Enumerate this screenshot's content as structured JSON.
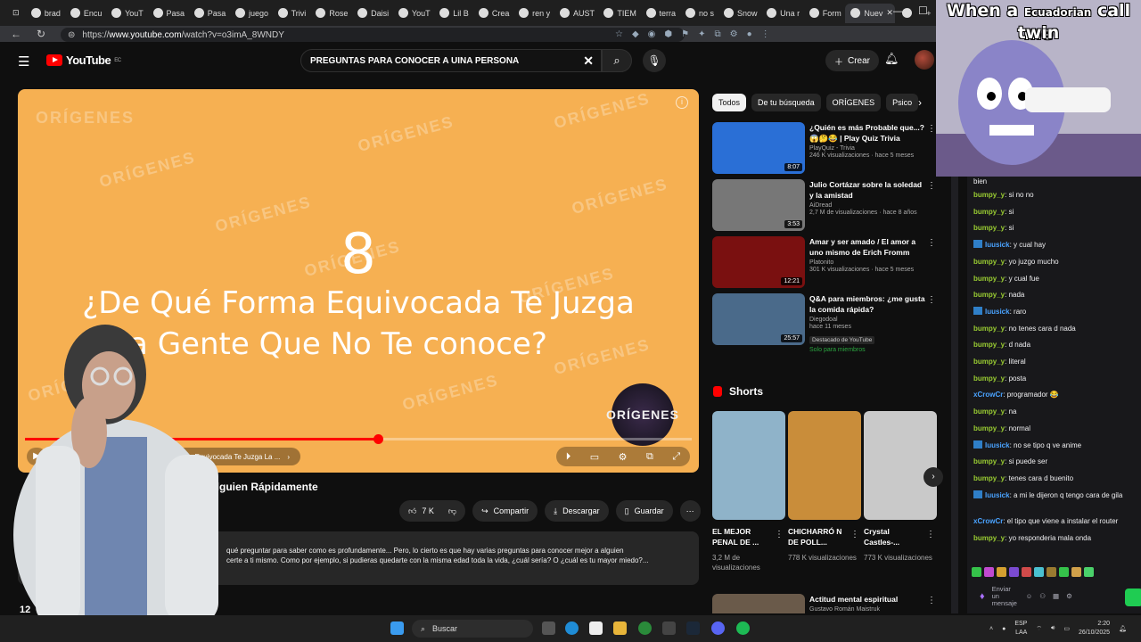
{
  "browser": {
    "tabs": [
      "brad",
      "Encu",
      "YouT",
      "Pasa",
      "Pasa",
      "juego",
      "Trivi",
      "Rose",
      "Daisi",
      "YouT",
      "Lil B",
      "Crea",
      "ren y",
      "AUST",
      "TIEM",
      "terra",
      "no s",
      "Snow",
      "Una r",
      "Form",
      "Nuev",
      ""
    ],
    "url_prefix": "https://",
    "url_host": "www.youtube.com",
    "url_path": "/watch?v=o3imA_8WNDY"
  },
  "youtube": {
    "logo_text": "YouTube",
    "logo_country": "EC",
    "search_value": "PREGUNTAS PARA CONOCER A UINA PERSONA",
    "create_label": "Crear"
  },
  "player": {
    "watermark": "ORÍGENES",
    "number": "8",
    "question_line1": "¿De Qué Forma Equivocada Te Juzga",
    "question_line2": "La Gente Que No Te conoce?",
    "chapter_label": "ué Forma Equivocada Te Juzga La ...",
    "channel_logo_text": "ORÍGENES",
    "progress_fraction": 0.53
  },
  "video": {
    "title_visible": "Alguien Rápidamente",
    "likes": "7 K",
    "share_label": "Compartir",
    "download_label": "Descargar",
    "save_label": "Guardar",
    "description_line1": "qué preguntar para saber como es profundamente... Pero, lo cierto es que hay varias preguntas para conocer mejor a alguien",
    "description_line2": "certe a ti mismo. Como por ejemplo, si pudieras quedarte con la misma edad toda la vida, ¿cuál sería? O ¿cuál es tu mayor miedo?...",
    "view_fragment": "12"
  },
  "sidebar": {
    "chips": [
      "Todos",
      "De tu búsqueda",
      "ORÍGENES",
      "Psico"
    ],
    "recommendations": [
      {
        "title": "¿Quién es más Probable que...? 😱🤔😂 | Play Quiz Trivia",
        "channel": "PlayQuiz - Trivia",
        "views": "246 K visualizaciones · hace 5 meses",
        "duration": "8:07",
        "thumb_color": "#2a6fd6",
        "badge": "",
        "badge2": ""
      },
      {
        "title": "Julio Cortázar sobre la soledad y la amistad",
        "channel": "AiDread",
        "views": "2,7 M de visualizaciones · hace 8 años",
        "duration": "3:53",
        "thumb_color": "#777777",
        "badge": "",
        "badge2": ""
      },
      {
        "title": "Amar y ser amado / El amor a uno mismo de Erich Fromm",
        "channel": "Platonito",
        "views": "301 K visualizaciones · hace 5 meses",
        "duration": "12:21",
        "thumb_color": "#7a1010",
        "badge": "",
        "badge2": ""
      },
      {
        "title": "Q&A para miembros: ¿me gusta la comida rápida?",
        "channel": "Diegodoal",
        "views": "hace 11 meses",
        "duration": "25:57",
        "thumb_color": "#4a6a8a",
        "badge": "Destacado de YouTube",
        "badge2": "Solo para miembros"
      }
    ],
    "shorts_heading": "Shorts",
    "shorts": [
      {
        "title": "EL MEJOR PENAL DE ...",
        "views": "3,2 M de visualizaciones",
        "color": "#8fb3c9"
      },
      {
        "title": "CHICHARRÓ N DE POLL...",
        "views": "778 K visualizaciones",
        "color": "#c98d3a"
      },
      {
        "title": "Crystal Castles-...",
        "views": "773 K visualizaciones",
        "color": "#c9c9c9"
      }
    ],
    "last_rec_title": "Actitud mental espiritual",
    "last_rec_channel": "Gustavo Román Maistruk"
  },
  "chat": {
    "top_fragment": "bien",
    "messages": [
      {
        "user": "bumpy_y",
        "text": "si no no",
        "mod": false,
        "color": "#9acd32"
      },
      {
        "user": "bumpy_y",
        "text": "si",
        "mod": false,
        "color": "#9acd32"
      },
      {
        "user": "bumpy_y",
        "text": "si",
        "mod": false,
        "color": "#9acd32"
      },
      {
        "user": "luusick",
        "text": "y cual hay",
        "mod": true,
        "color": "#4aa3ff"
      },
      {
        "user": "bumpy_y",
        "text": "yo juzgo mucho",
        "mod": false,
        "color": "#9acd32"
      },
      {
        "user": "bumpy_y",
        "text": "y cual fue",
        "mod": false,
        "color": "#9acd32"
      },
      {
        "user": "bumpy_y",
        "text": "nada",
        "mod": false,
        "color": "#9acd32"
      },
      {
        "user": "luusick",
        "text": "raro",
        "mod": true,
        "color": "#4aa3ff"
      },
      {
        "user": "bumpy_y",
        "text": "no tenes cara d nada",
        "mod": false,
        "color": "#9acd32"
      },
      {
        "user": "bumpy_y",
        "text": "d nada",
        "mod": false,
        "color": "#9acd32"
      },
      {
        "user": "bumpy_y",
        "text": "literal",
        "mod": false,
        "color": "#9acd32"
      },
      {
        "user": "bumpy_y",
        "text": "posta",
        "mod": false,
        "color": "#9acd32"
      },
      {
        "user": "xCrowCr",
        "text": "programador 😂",
        "mod": false,
        "color": "#4aa3ff"
      },
      {
        "user": "bumpy_y",
        "text": "na",
        "mod": false,
        "color": "#9acd32"
      },
      {
        "user": "bumpy_y",
        "text": "normal",
        "mod": false,
        "color": "#9acd32"
      },
      {
        "user": "luusick",
        "text": "no se tipo q ve anime",
        "mod": true,
        "color": "#4aa3ff"
      },
      {
        "user": "bumpy_y",
        "text": "si puede ser",
        "mod": false,
        "color": "#9acd32"
      },
      {
        "user": "bumpy_y",
        "text": "tenes cara d buenito",
        "mod": false,
        "color": "#9acd32"
      },
      {
        "user": "luusick",
        "text": "a mi le dijeron q tengo cara de gila",
        "mod": true,
        "color": "#4aa3ff"
      },
      {
        "user": "xCrowCr",
        "text": "el tipo que viene a instalar el router",
        "mod": false,
        "color": "#4aa3ff"
      },
      {
        "user": "bumpy_y",
        "text": "yo responderia mala onda",
        "mod": false,
        "color": "#9acd32"
      }
    ],
    "input_placeholder": "Enviar un mensaje"
  },
  "meme": {
    "caption_a": "When a",
    "caption_b": "Ecuadorian",
    "caption_c": "call me",
    "caption_d": "twin"
  },
  "taskbar": {
    "search_label": "Buscar",
    "lang_line1": "ESP",
    "lang_line2": "LAA",
    "time": "2:20",
    "date": "26/10/2025"
  }
}
